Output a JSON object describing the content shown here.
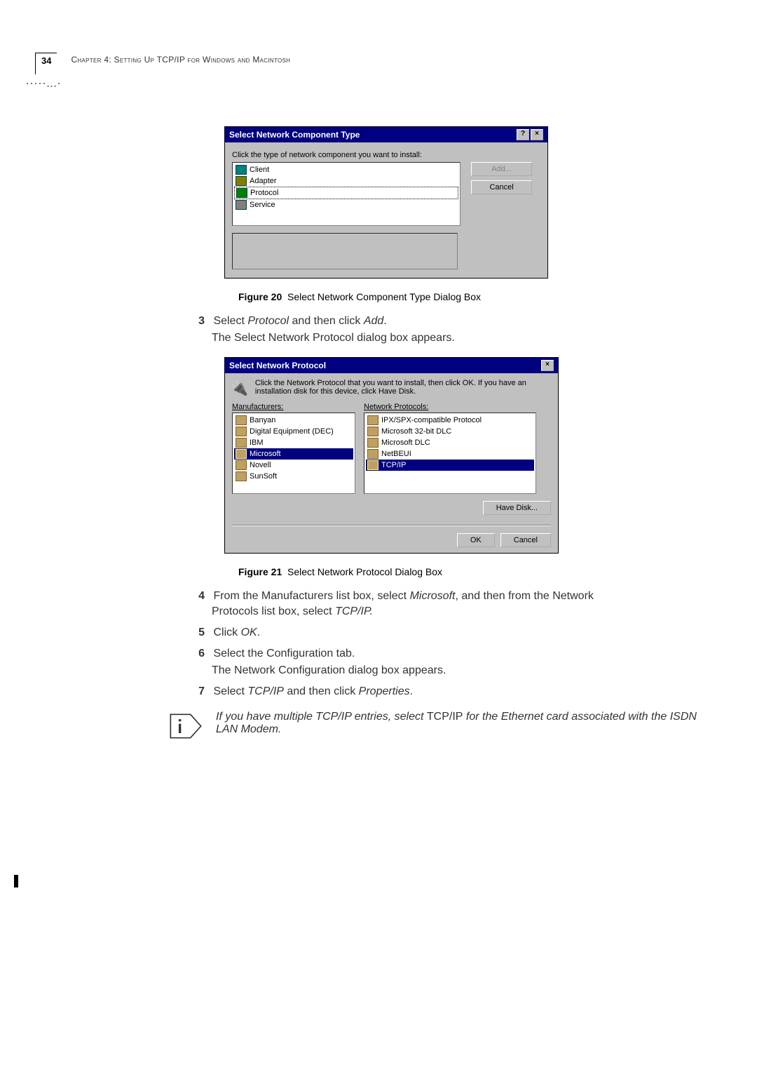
{
  "header": {
    "page_number": "34",
    "chapter_line": "Chapter 4: Setting Up TCP/IP for Windows and Macintosh"
  },
  "dialog1": {
    "title": "Select Network Component Type",
    "instruction": "Click the type of network component you want to install:",
    "items": {
      "client": "Client",
      "adapter": "Adapter",
      "protocol": "Protocol",
      "service": "Service"
    },
    "buttons": {
      "add": "Add...",
      "cancel": "Cancel"
    }
  },
  "figure20": {
    "label": "Figure 20",
    "caption": "Select Network Component Type Dialog Box"
  },
  "step3": {
    "num": "3",
    "text_a": "Select ",
    "text_b": "Protocol",
    "text_c": " and then click ",
    "text_d": "Add",
    "text_e": "."
  },
  "step3_result": "The Select Network Protocol dialog box appears.",
  "dialog2": {
    "title": "Select Network Protocol",
    "desc": "Click the Network Protocol that you want to install, then click OK. If you have an installation disk for this device, click Have Disk.",
    "left_label": "Manufacturers:",
    "right_label": "Network Protocols:",
    "manufacturers": {
      "banyan": "Banyan",
      "dec": "Digital Equipment (DEC)",
      "ibm": "IBM",
      "microsoft": "Microsoft",
      "novell": "Novell",
      "sunsoft": "SunSoft"
    },
    "protocols": {
      "ipx": "IPX/SPX-compatible Protocol",
      "dlc32": "Microsoft 32-bit DLC",
      "dlc": "Microsoft DLC",
      "netbeui": "NetBEUI",
      "tcpip": "TCP/IP"
    },
    "buttons": {
      "have_disk": "Have Disk...",
      "ok": "OK",
      "cancel": "Cancel"
    }
  },
  "figure21": {
    "label": "Figure 21",
    "caption": "Select Network Protocol Dialog Box"
  },
  "step4": {
    "num": "4",
    "line1a": "From the Manufacturers list box, select ",
    "line1b": "Microsoft",
    "line1c": ", and then from the Network",
    "line2a": "Protocols list box, select ",
    "line2b": "TCP/IP."
  },
  "step5": {
    "num": "5",
    "text_a": "Click ",
    "text_b": "OK",
    "text_c": "."
  },
  "step6": {
    "num": "6",
    "text": "Select the Configuration tab."
  },
  "step6_result": "The Network Configuration dialog box appears.",
  "step7": {
    "num": "7",
    "text_a": "Select ",
    "text_b": "TCP/IP",
    "text_c": " and then click ",
    "text_d": "Properties",
    "text_e": "."
  },
  "note": {
    "part1": "If you have multiple TCP/IP entries, select ",
    "upright": "TCP/IP",
    "part2": " for the Ethernet card associated with the ISDN LAN Modem."
  }
}
